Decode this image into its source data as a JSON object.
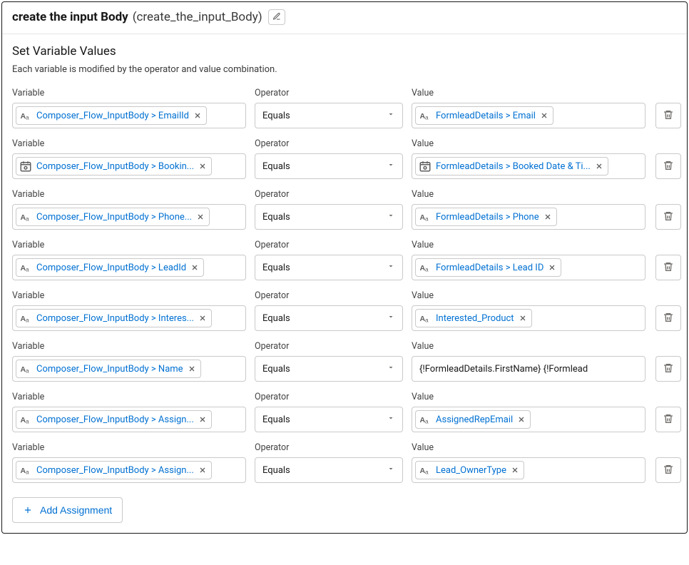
{
  "header": {
    "title": "create the input Body",
    "api_name": "(create_the_input_Body)"
  },
  "section": {
    "title": "Set Variable Values",
    "description": "Each variable is modified by the operator and value combination."
  },
  "labels": {
    "variable": "Variable",
    "operator": "Operator",
    "value": "Value",
    "add_assignment": "Add Assignment"
  },
  "rows": [
    {
      "variable_icon": "text",
      "variable": "Composer_Flow_InputBody > EmailId",
      "operator": "Equals",
      "value_type": "token",
      "value_icon": "text",
      "value": "FormleadDetails > Email"
    },
    {
      "variable_icon": "date",
      "variable": "Composer_Flow_InputBody > Bookin...",
      "operator": "Equals",
      "value_type": "token",
      "value_icon": "date",
      "value": "FormleadDetails > Booked Date & Ti..."
    },
    {
      "variable_icon": "text",
      "variable": "Composer_Flow_InputBody > Phone...",
      "operator": "Equals",
      "value_type": "token",
      "value_icon": "text",
      "value": "FormleadDetails > Phone"
    },
    {
      "variable_icon": "text",
      "variable": "Composer_Flow_InputBody > LeadId",
      "operator": "Equals",
      "value_type": "token",
      "value_icon": "text",
      "value": "FormleadDetails > Lead ID"
    },
    {
      "variable_icon": "text",
      "variable": "Composer_Flow_InputBody > Interes...",
      "operator": "Equals",
      "value_type": "token",
      "value_icon": "text",
      "value": "Interested_Product"
    },
    {
      "variable_icon": "text",
      "variable": "Composer_Flow_InputBody > Name",
      "operator": "Equals",
      "value_type": "text",
      "value": "{!FormleadDetails.FirstName} {!Formlead"
    },
    {
      "variable_icon": "text",
      "variable": "Composer_Flow_InputBody > Assign...",
      "operator": "Equals",
      "value_type": "token",
      "value_icon": "text",
      "value": "AssignedRepEmail"
    },
    {
      "variable_icon": "text",
      "variable": "Composer_Flow_InputBody > Assign...",
      "operator": "Equals",
      "value_type": "token",
      "value_icon": "text",
      "value": "Lead_OwnerType"
    }
  ]
}
